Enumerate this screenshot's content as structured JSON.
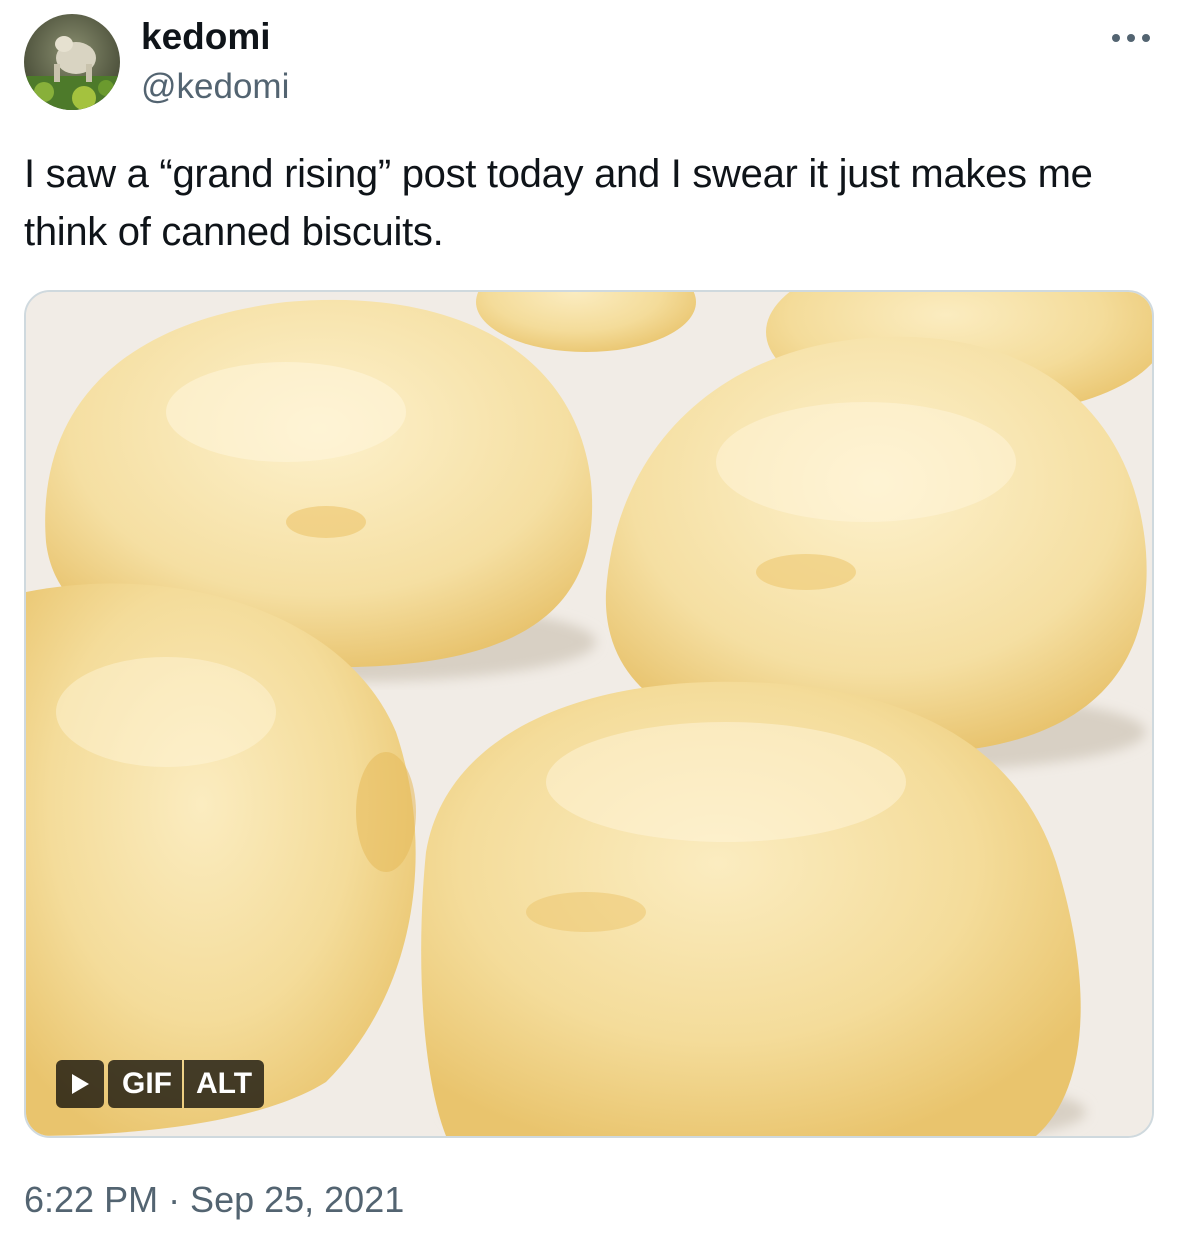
{
  "author": {
    "display_name": "kedomi",
    "handle": "@kedomi"
  },
  "tweet": {
    "text": "I saw a “grand rising” post today and I swear it just makes me think of canned biscuits.",
    "timestamp": "6:22 PM · Sep 25, 2021"
  },
  "media": {
    "type": "gif",
    "gif_label": "GIF",
    "alt_label": "ALT"
  },
  "icons": {
    "more": "more-horizontal-icon",
    "play": "play-icon"
  },
  "colors": {
    "text_primary": "#0f1419",
    "text_secondary": "#536471",
    "media_border": "#cfd9de"
  }
}
